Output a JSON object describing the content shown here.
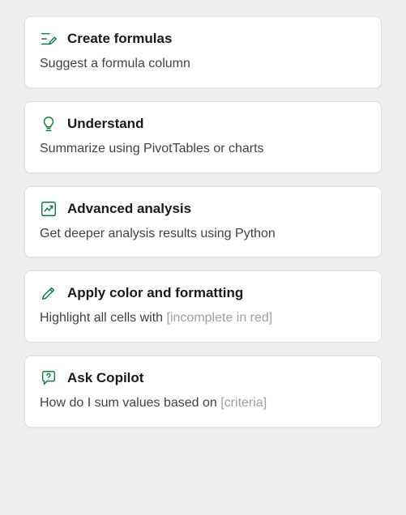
{
  "accent": "#107c41",
  "cards": [
    {
      "icon": "formula-pen-icon",
      "title": "Create formulas",
      "desc": "Suggest a formula column",
      "placeholder": ""
    },
    {
      "icon": "lightbulb-icon",
      "title": "Understand",
      "desc": "Summarize using PivotTables or charts",
      "placeholder": ""
    },
    {
      "icon": "trend-icon",
      "title": "Advanced analysis",
      "desc": "Get deeper analysis results using Python",
      "placeholder": ""
    },
    {
      "icon": "pencil-icon",
      "title": "Apply color and formatting",
      "desc": "Highlight all cells with ",
      "placeholder": "[incomplete in red]"
    },
    {
      "icon": "chat-question-icon",
      "title": "Ask Copilot",
      "desc": "How do I sum values based on ",
      "placeholder": "[criteria]"
    }
  ]
}
